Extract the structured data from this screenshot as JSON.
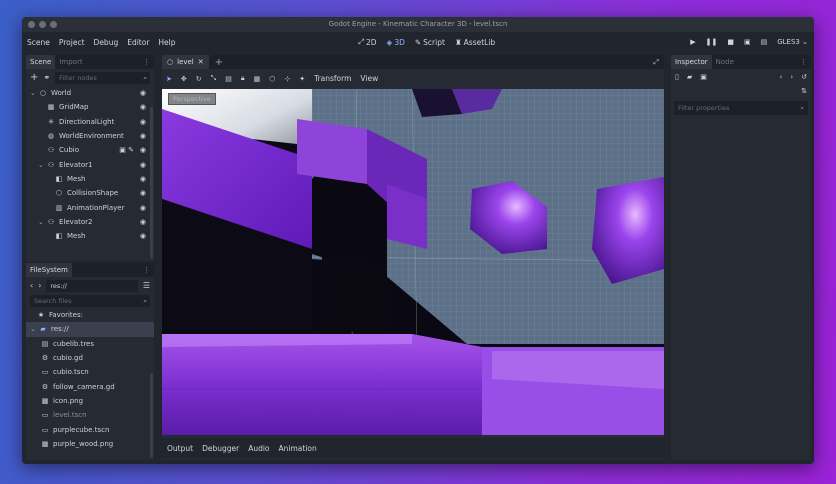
{
  "window": {
    "title": "Godot Engine - Kinematic Character 3D - level.tscn"
  },
  "menu": [
    "Scene",
    "Project",
    "Debug",
    "Editor",
    "Help"
  ],
  "modes": [
    {
      "label": "2D",
      "icon": "2d-icon"
    },
    {
      "label": "3D",
      "icon": "3d-icon",
      "active": true
    },
    {
      "label": "Script",
      "icon": "script-icon"
    },
    {
      "label": "AssetLib",
      "icon": "assetlib-icon"
    }
  ],
  "renderer": "GLES3",
  "scene_dock": {
    "tabs": [
      "Scene",
      "Import"
    ],
    "filter_placeholder": "Filter nodes",
    "nodes": [
      {
        "label": "World",
        "icon": "spatial-icon",
        "indent": 0,
        "expand": "v"
      },
      {
        "label": "GridMap",
        "icon": "gridmap-icon",
        "indent": 1
      },
      {
        "label": "DirectionalLight",
        "icon": "light-icon",
        "indent": 1
      },
      {
        "label": "WorldEnvironment",
        "icon": "environment-icon",
        "indent": 1
      },
      {
        "label": "Cubio",
        "icon": "kinematic-icon",
        "indent": 1,
        "extra": true
      },
      {
        "label": "Elevator1",
        "icon": "kinematic-icon",
        "indent": 1,
        "expand": "v"
      },
      {
        "label": "Mesh",
        "icon": "mesh-icon",
        "indent": 2
      },
      {
        "label": "CollisionShape",
        "icon": "collision-icon",
        "indent": 2
      },
      {
        "label": "AnimationPlayer",
        "icon": "animation-icon",
        "indent": 2
      },
      {
        "label": "Elevator2",
        "icon": "kinematic-icon",
        "indent": 1,
        "expand": "v"
      },
      {
        "label": "Mesh",
        "icon": "mesh-icon",
        "indent": 2
      }
    ]
  },
  "filesystem": {
    "tab": "FileSystem",
    "path": "res://",
    "search_placeholder": "Search files",
    "favorites": "Favorites:",
    "root": "res://",
    "files": [
      {
        "label": "cubelib.tres",
        "icon": "resource-icon"
      },
      {
        "label": "cubio.gd",
        "icon": "gear-icon"
      },
      {
        "label": "cubio.tscn",
        "icon": "scene-icon"
      },
      {
        "label": "follow_camera.gd",
        "icon": "gear-icon"
      },
      {
        "label": "icon.png",
        "icon": "image-icon"
      },
      {
        "label": "level.tscn",
        "icon": "scene-icon",
        "dim": true
      },
      {
        "label": "purplecube.tscn",
        "icon": "scene-icon"
      },
      {
        "label": "purple_wood.png",
        "icon": "image-icon"
      }
    ]
  },
  "viewport": {
    "tab": "level",
    "menus": [
      "Transform",
      "View"
    ],
    "label": "Perspective"
  },
  "bottom_tabs": [
    "Output",
    "Debugger",
    "Audio",
    "Animation"
  ],
  "inspector": {
    "tabs": [
      "Inspector",
      "Node"
    ],
    "filter_placeholder": "Filter properties"
  },
  "colors": {
    "accent": "#8fb4ff",
    "purple": "#7a2fd0"
  }
}
